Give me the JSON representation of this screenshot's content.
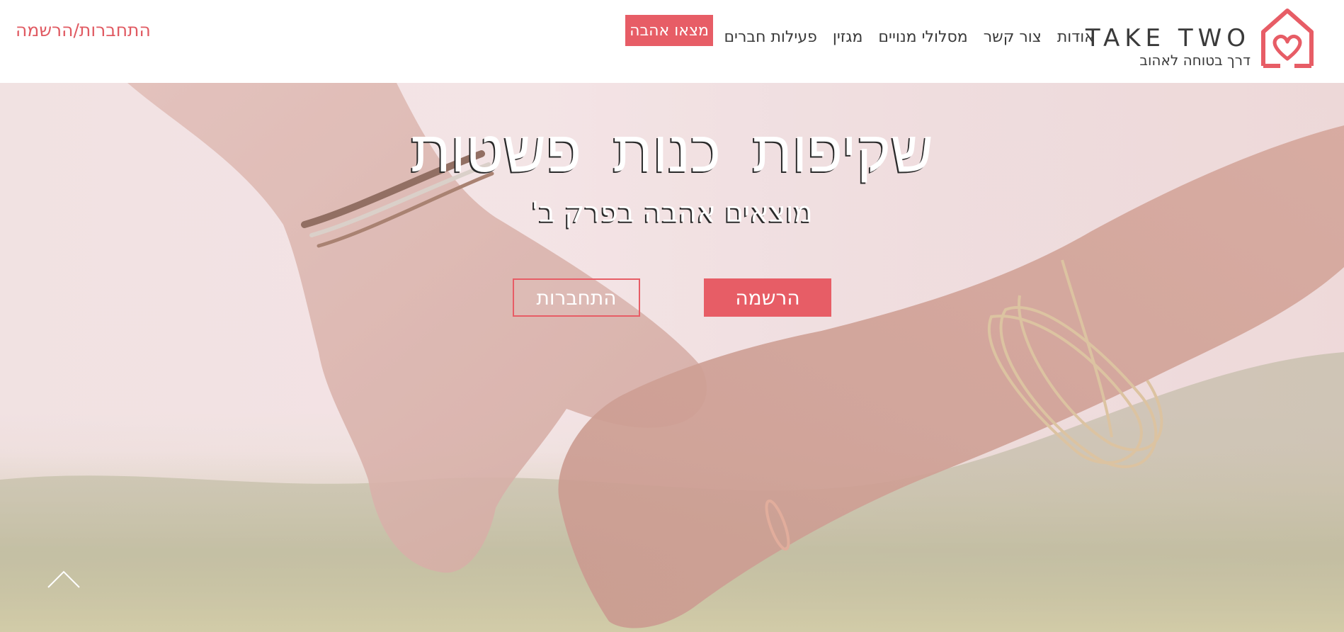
{
  "header": {
    "auth_link": "התחברות/הרשמה",
    "logo": {
      "title": "TAKE TWO",
      "tagline": "דרך בטוחה לאהוב",
      "icon": "house-heart-icon"
    },
    "nav": {
      "items": [
        {
          "label": "אודות"
        },
        {
          "label": "צור קשר"
        },
        {
          "label": "מסלולי מנויים"
        },
        {
          "label": "מגזין"
        },
        {
          "label": "פעילות חברים"
        }
      ],
      "cta_label": "מצאו אהבה"
    }
  },
  "hero": {
    "title": "שקיפות כנות פשטות",
    "subtitle": "מוצאים אהבה בפרק ב'",
    "register_label": "הרשמה",
    "login_label": "התחברות",
    "background": "holding-hands-photo",
    "scroll_icon": "chevron-up-icon"
  },
  "colors": {
    "accent": "#e75d66",
    "text_dark": "#3a3a3a",
    "white": "#ffffff"
  }
}
